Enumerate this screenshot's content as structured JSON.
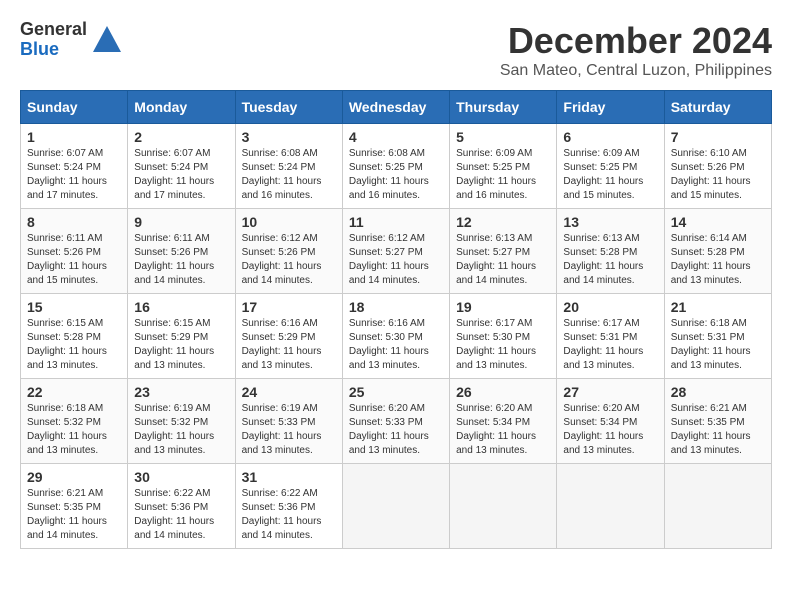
{
  "header": {
    "logo_general": "General",
    "logo_blue": "Blue",
    "title": "December 2024",
    "subtitle": "San Mateo, Central Luzon, Philippines"
  },
  "calendar": {
    "days_of_week": [
      "Sunday",
      "Monday",
      "Tuesday",
      "Wednesday",
      "Thursday",
      "Friday",
      "Saturday"
    ],
    "weeks": [
      [
        {
          "day": "",
          "empty": true
        },
        {
          "day": "",
          "empty": true
        },
        {
          "day": "",
          "empty": true
        },
        {
          "day": "",
          "empty": true
        },
        {
          "day": "",
          "empty": true
        },
        {
          "day": "",
          "empty": true
        },
        {
          "day": "",
          "empty": true
        }
      ],
      [
        {
          "day": "1",
          "sunrise": "6:07 AM",
          "sunset": "5:24 PM",
          "daylight": "11 hours and 17 minutes."
        },
        {
          "day": "2",
          "sunrise": "6:07 AM",
          "sunset": "5:24 PM",
          "daylight": "11 hours and 17 minutes."
        },
        {
          "day": "3",
          "sunrise": "6:08 AM",
          "sunset": "5:24 PM",
          "daylight": "11 hours and 16 minutes."
        },
        {
          "day": "4",
          "sunrise": "6:08 AM",
          "sunset": "5:25 PM",
          "daylight": "11 hours and 16 minutes."
        },
        {
          "day": "5",
          "sunrise": "6:09 AM",
          "sunset": "5:25 PM",
          "daylight": "11 hours and 16 minutes."
        },
        {
          "day": "6",
          "sunrise": "6:09 AM",
          "sunset": "5:25 PM",
          "daylight": "11 hours and 15 minutes."
        },
        {
          "day": "7",
          "sunrise": "6:10 AM",
          "sunset": "5:26 PM",
          "daylight": "11 hours and 15 minutes."
        }
      ],
      [
        {
          "day": "8",
          "sunrise": "6:11 AM",
          "sunset": "5:26 PM",
          "daylight": "11 hours and 15 minutes."
        },
        {
          "day": "9",
          "sunrise": "6:11 AM",
          "sunset": "5:26 PM",
          "daylight": "11 hours and 14 minutes."
        },
        {
          "day": "10",
          "sunrise": "6:12 AM",
          "sunset": "5:26 PM",
          "daylight": "11 hours and 14 minutes."
        },
        {
          "day": "11",
          "sunrise": "6:12 AM",
          "sunset": "5:27 PM",
          "daylight": "11 hours and 14 minutes."
        },
        {
          "day": "12",
          "sunrise": "6:13 AM",
          "sunset": "5:27 PM",
          "daylight": "11 hours and 14 minutes."
        },
        {
          "day": "13",
          "sunrise": "6:13 AM",
          "sunset": "5:28 PM",
          "daylight": "11 hours and 14 minutes."
        },
        {
          "day": "14",
          "sunrise": "6:14 AM",
          "sunset": "5:28 PM",
          "daylight": "11 hours and 13 minutes."
        }
      ],
      [
        {
          "day": "15",
          "sunrise": "6:15 AM",
          "sunset": "5:28 PM",
          "daylight": "11 hours and 13 minutes."
        },
        {
          "day": "16",
          "sunrise": "6:15 AM",
          "sunset": "5:29 PM",
          "daylight": "11 hours and 13 minutes."
        },
        {
          "day": "17",
          "sunrise": "6:16 AM",
          "sunset": "5:29 PM",
          "daylight": "11 hours and 13 minutes."
        },
        {
          "day": "18",
          "sunrise": "6:16 AM",
          "sunset": "5:30 PM",
          "daylight": "11 hours and 13 minutes."
        },
        {
          "day": "19",
          "sunrise": "6:17 AM",
          "sunset": "5:30 PM",
          "daylight": "11 hours and 13 minutes."
        },
        {
          "day": "20",
          "sunrise": "6:17 AM",
          "sunset": "5:31 PM",
          "daylight": "11 hours and 13 minutes."
        },
        {
          "day": "21",
          "sunrise": "6:18 AM",
          "sunset": "5:31 PM",
          "daylight": "11 hours and 13 minutes."
        }
      ],
      [
        {
          "day": "22",
          "sunrise": "6:18 AM",
          "sunset": "5:32 PM",
          "daylight": "11 hours and 13 minutes."
        },
        {
          "day": "23",
          "sunrise": "6:19 AM",
          "sunset": "5:32 PM",
          "daylight": "11 hours and 13 minutes."
        },
        {
          "day": "24",
          "sunrise": "6:19 AM",
          "sunset": "5:33 PM",
          "daylight": "11 hours and 13 minutes."
        },
        {
          "day": "25",
          "sunrise": "6:20 AM",
          "sunset": "5:33 PM",
          "daylight": "11 hours and 13 minutes."
        },
        {
          "day": "26",
          "sunrise": "6:20 AM",
          "sunset": "5:34 PM",
          "daylight": "11 hours and 13 minutes."
        },
        {
          "day": "27",
          "sunrise": "6:20 AM",
          "sunset": "5:34 PM",
          "daylight": "11 hours and 13 minutes."
        },
        {
          "day": "28",
          "sunrise": "6:21 AM",
          "sunset": "5:35 PM",
          "daylight": "11 hours and 13 minutes."
        }
      ],
      [
        {
          "day": "29",
          "sunrise": "6:21 AM",
          "sunset": "5:35 PM",
          "daylight": "11 hours and 14 minutes."
        },
        {
          "day": "30",
          "sunrise": "6:22 AM",
          "sunset": "5:36 PM",
          "daylight": "11 hours and 14 minutes."
        },
        {
          "day": "31",
          "sunrise": "6:22 AM",
          "sunset": "5:36 PM",
          "daylight": "11 hours and 14 minutes."
        },
        {
          "day": "",
          "empty": true
        },
        {
          "day": "",
          "empty": true
        },
        {
          "day": "",
          "empty": true
        },
        {
          "day": "",
          "empty": true
        }
      ]
    ],
    "labels": {
      "sunrise": "Sunrise:",
      "sunset": "Sunset:",
      "daylight": "Daylight:"
    }
  }
}
